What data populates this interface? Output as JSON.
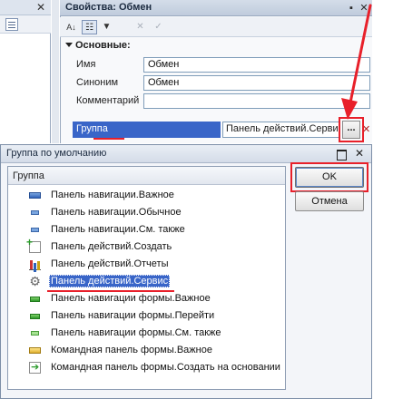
{
  "properties_window": {
    "title": "Свойства: Обмен",
    "toolbar": {
      "sort_label": "A↓",
      "close_label": "✕",
      "check_label": "✓"
    },
    "section": "Основные:",
    "fields": [
      {
        "label": "Имя",
        "value": "Обмен"
      },
      {
        "label": "Синоним",
        "value": "Обмен"
      },
      {
        "label": "Комментарий",
        "value": ""
      }
    ],
    "group_label": "Группа",
    "group_value": "Панель действий.Сервис",
    "group_select_label": "...",
    "group_clear_label": "✕"
  },
  "dialog": {
    "title": "Группа по умолчанию",
    "column_header": "Группа",
    "items": [
      {
        "label": "Панель навигации.Важное",
        "icon": "nav-important-icon"
      },
      {
        "label": "Панель навигации.Обычное",
        "icon": "nav-normal-icon"
      },
      {
        "label": "Панель навигации.См. также",
        "icon": "nav-see-also-icon"
      },
      {
        "label": "Панель действий.Создать",
        "icon": "create-icon"
      },
      {
        "label": "Панель действий.Отчеты",
        "icon": "reports-icon"
      },
      {
        "label": "Панель действий.Сервис",
        "icon": "gear-icon",
        "selected": true
      },
      {
        "label": "Панель навигации формы.Важное",
        "icon": "form-nav-important-icon"
      },
      {
        "label": "Панель навигации формы.Перейти",
        "icon": "form-nav-go-icon"
      },
      {
        "label": "Панель навигации формы.См. также",
        "icon": "form-nav-see-also-icon"
      },
      {
        "label": "Командная панель формы.Важное",
        "icon": "form-command-important-icon"
      },
      {
        "label": "Командная панель формы.Создать на основании",
        "icon": "create-based-on-icon"
      }
    ],
    "ok_label": "OK",
    "cancel_label": "Отмена"
  },
  "annotation_color": "#e8202a"
}
